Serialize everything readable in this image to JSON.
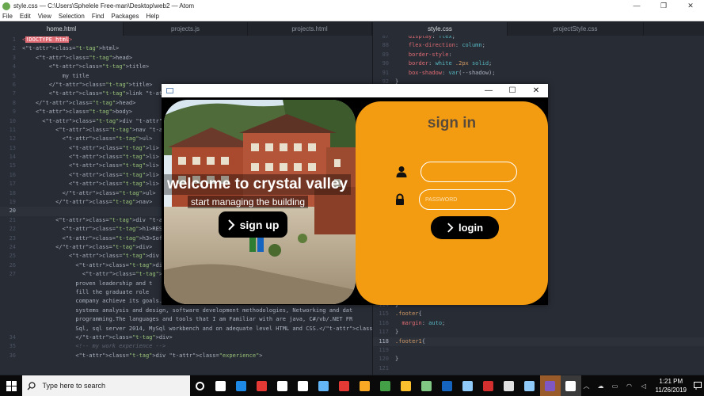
{
  "atom": {
    "window_title": "style.css — C:\\Users\\Sphelele Free-man\\Desktop\\web2 — Atom",
    "menu": [
      "File",
      "Edit",
      "View",
      "Selection",
      "Find",
      "Packages",
      "Help"
    ],
    "tabs_left": [
      "home.html",
      "projects.js",
      "projects.html"
    ],
    "tabs_right": [
      "style.css",
      "projectStyle.css"
    ],
    "window_controls": [
      "—",
      "❐",
      "✕"
    ]
  },
  "left_lines": [
    {
      "n": "1",
      "code": "<!DOCTYPE html>"
    },
    {
      "n": "2",
      "code": "<html>"
    },
    {
      "n": "3",
      "code": "    <head>"
    },
    {
      "n": "4",
      "code": "        <title>"
    },
    {
      "n": "5",
      "code": "            my title"
    },
    {
      "n": "6",
      "code": "        </title>"
    },
    {
      "n": "7",
      "code": "        <link rel=\"stylesheet\" href=\"css/"
    },
    {
      "n": "8",
      "code": "    </head>"
    },
    {
      "n": "9",
      "code": "    <body>"
    },
    {
      "n": "10",
      "code": "      <div class=\"container\">"
    },
    {
      "n": "11",
      "code": "          <nav class=\"nav\">"
    },
    {
      "n": "12",
      "code": "            <ul>"
    },
    {
      "n": "13",
      "code": "              <li> <a href=\"#\">HOME</a>"
    },
    {
      "n": "14",
      "code": "              <li> <a href=\"#\">EXPERIEN"
    },
    {
      "n": "15",
      "code": "              <li> <a href=\"#\">PROJECTS"
    },
    {
      "n": "16",
      "code": "              <li> <a href=\"#\">EDUCATIO"
    },
    {
      "n": "17",
      "code": "              <li> <a href=\"#\">INTEREST"
    },
    {
      "n": "18",
      "code": "            </ul>"
    },
    {
      "n": "19",
      "code": "          </nav>"
    },
    {
      "n": "20",
      "code": ""
    },
    {
      "n": "21",
      "code": "          <div class=\"box header\" style="
    },
    {
      "n": "22",
      "code": "            <h1>RESUME OF SPHELELE FREE"
    },
    {
      "n": "23",
      "code": "            <h3>Software Developer</h3>"
    },
    {
      "n": "24",
      "code": "          </div>"
    },
    {
      "n": "25",
      "code": "              <div class=\"main\">"
    },
    {
      "n": "26",
      "code": "                <div class=\" box profil"
    },
    {
      "n": "27",
      "code": "                  <p>I am a quility ori"
    },
    {
      "n": "",
      "code": "                proven leadership and t"
    },
    {
      "n": "",
      "code": "                fill the graduate role"
    },
    {
      "n": "",
      "code": "                company achieve its goals. During my undergraduate studies I obtained the following"
    },
    {
      "n": "",
      "code": "                systems analysis and design, software development methodologies, Networking and dat"
    },
    {
      "n": "",
      "code": "                programming.The languages and tools that I am Familiar with are java, C#/vb/.NET FR"
    },
    {
      "n": "",
      "code": "                Sql, sql server 2014, MySql workbench and on adequate level HTML and CSS.</p>"
    },
    {
      "n": "34",
      "code": "                </div>"
    },
    {
      "n": "35",
      "code": "                <!-- my work experience -->"
    },
    {
      "n": "36",
      "code": "                <div class=\"experience\">"
    }
  ],
  "right_lines_top": [
    {
      "n": "87",
      "code": "    display: flex;"
    },
    {
      "n": "88",
      "code": "    flex-direction: column;"
    },
    {
      "n": "89",
      "code": "    border-style:"
    },
    {
      "n": "90",
      "code": "    border: white .2px solid;"
    },
    {
      "n": "91",
      "code": "    box-shadow: var(--shadow);"
    },
    {
      "n": "92",
      "code": "}"
    }
  ],
  "right_lines_bottom": [
    {
      "n": "114",
      "code": "}"
    },
    {
      "n": "115",
      "code": ".footer{"
    },
    {
      "n": "116",
      "code": "  margin: auto;"
    },
    {
      "n": "117",
      "code": "}"
    },
    {
      "n": "118",
      "code": ".footer1{"
    },
    {
      "n": "119",
      "code": ""
    },
    {
      "n": "120",
      "code": "}"
    },
    {
      "n": "121",
      "code": ""
    }
  ],
  "app": {
    "window_controls": [
      "—",
      "☐",
      "✕"
    ],
    "hero_title": "welcome to crystal valley",
    "hero_subtitle": "start managing the building",
    "signup_label": "sign up",
    "signin_title": "sign in",
    "username_placeholder": "",
    "password_placeholder": "PASSWORD",
    "login_label": "login"
  },
  "taskbar": {
    "search_placeholder": "Type here to search",
    "time": "1:21 PM",
    "date": "11/26/2019",
    "pinned": [
      {
        "name": "task-view",
        "color": "#ffffff"
      },
      {
        "name": "file-explorer",
        "color": "#ffffff"
      },
      {
        "name": "edge",
        "color": "#1e88e5"
      },
      {
        "name": "adobe",
        "color": "#e53935"
      },
      {
        "name": "mail",
        "color": "#ffffff"
      },
      {
        "name": "store",
        "color": "#ffffff"
      },
      {
        "name": "monitor",
        "color": "#64b5f6"
      },
      {
        "name": "opera",
        "color": "#e53935"
      },
      {
        "name": "folder",
        "color": "#f9a825"
      },
      {
        "name": "sticky",
        "color": "#43a047"
      },
      {
        "name": "chrome",
        "color": "#fbc02d"
      },
      {
        "name": "xbox",
        "color": "#81c784"
      },
      {
        "name": "firefox-dev",
        "color": "#1565c0"
      },
      {
        "name": "media",
        "color": "#90caf9"
      },
      {
        "name": "acrobat",
        "color": "#d32f2f"
      },
      {
        "name": "notepad",
        "color": "#e0e0e0"
      },
      {
        "name": "box-3d",
        "color": "#90caf9"
      },
      {
        "name": "visual-studio",
        "color": "#7e57c2"
      },
      {
        "name": "atom-app",
        "color": "#ffffff"
      }
    ]
  }
}
